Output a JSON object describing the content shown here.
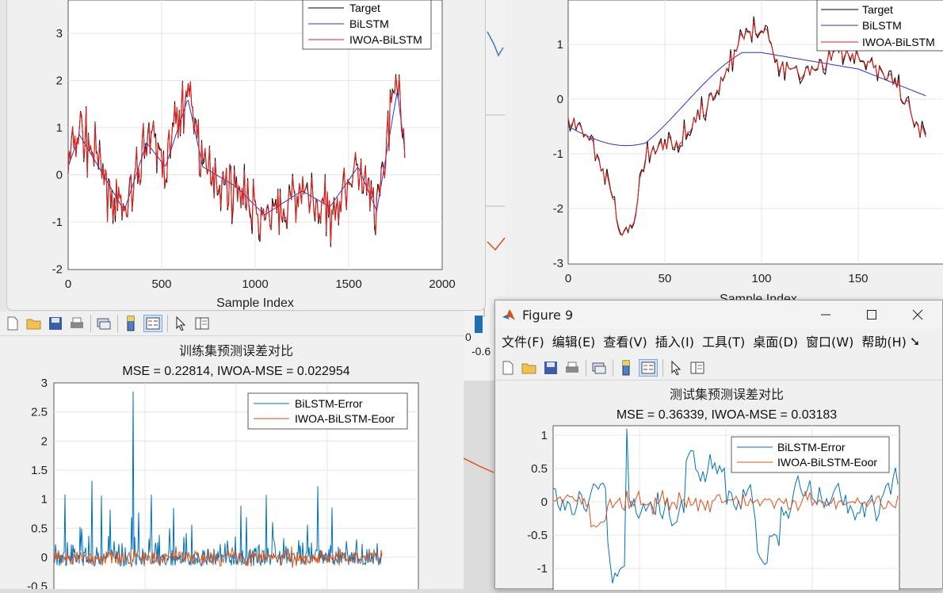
{
  "fig_train_pred": {
    "legend": [
      "Target",
      "BiLSTM",
      "IWOA-BiLSTM"
    ],
    "xlabel": "Sample Index",
    "xticks": [
      "0",
      "500",
      "1000",
      "1500",
      "2000"
    ],
    "yticks": [
      "3",
      "2",
      "1",
      "0",
      "-1",
      "-2"
    ]
  },
  "fig_test_pred": {
    "legend": [
      "Target",
      "BiLSTM",
      "IWOA-BiLSTM"
    ],
    "xlabel": "Sample Index",
    "xticks": [
      "0",
      "50",
      "100",
      "150"
    ],
    "yticks": [
      "1",
      "0",
      "-1",
      "-2",
      "-3"
    ]
  },
  "fig_train_err": {
    "title": "训练集预测误差对比",
    "subtitle": "MSE = 0.22814, IWOA-MSE = 0.022954",
    "legend": [
      "BiLSTM-Error",
      "IWOA-BiLSTM-Eoor"
    ],
    "yticks": [
      "3",
      "2.5",
      "2",
      "1.5",
      "1",
      "0.5",
      "0",
      "-0.5"
    ]
  },
  "fig_test_err": {
    "window_title": "Figure 9",
    "menus": [
      "文件(F)",
      "编辑(E)",
      "查看(V)",
      "插入(I)",
      "工具(T)",
      "桌面(D)",
      "窗口(W)",
      "帮助(H)"
    ],
    "title": "测试集预测误差对比",
    "subtitle": "MSE = 0.36339, IWOA-MSE = 0.03183",
    "legend": [
      "BiLSTM-Error",
      "IWOA-BiLSTM-Eoor"
    ],
    "yticks": [
      "1",
      "0.5",
      "0",
      "-0.5",
      "-1"
    ]
  },
  "background": {
    "tick_a": "0",
    "tick_b": "-0.6"
  },
  "colors": {
    "target": "#000000",
    "bilstm": "#2a35c8",
    "iwoa": "#e0201c",
    "err1": "#0072bd",
    "err2": "#d95319",
    "grid": "#e4e4e4"
  },
  "icons": [
    "new-file-icon",
    "open-folder-icon",
    "save-icon",
    "print-icon",
    "link-icon",
    "colorbar-icon",
    "legend-icon",
    "pointer-icon",
    "panel-icon"
  ]
}
